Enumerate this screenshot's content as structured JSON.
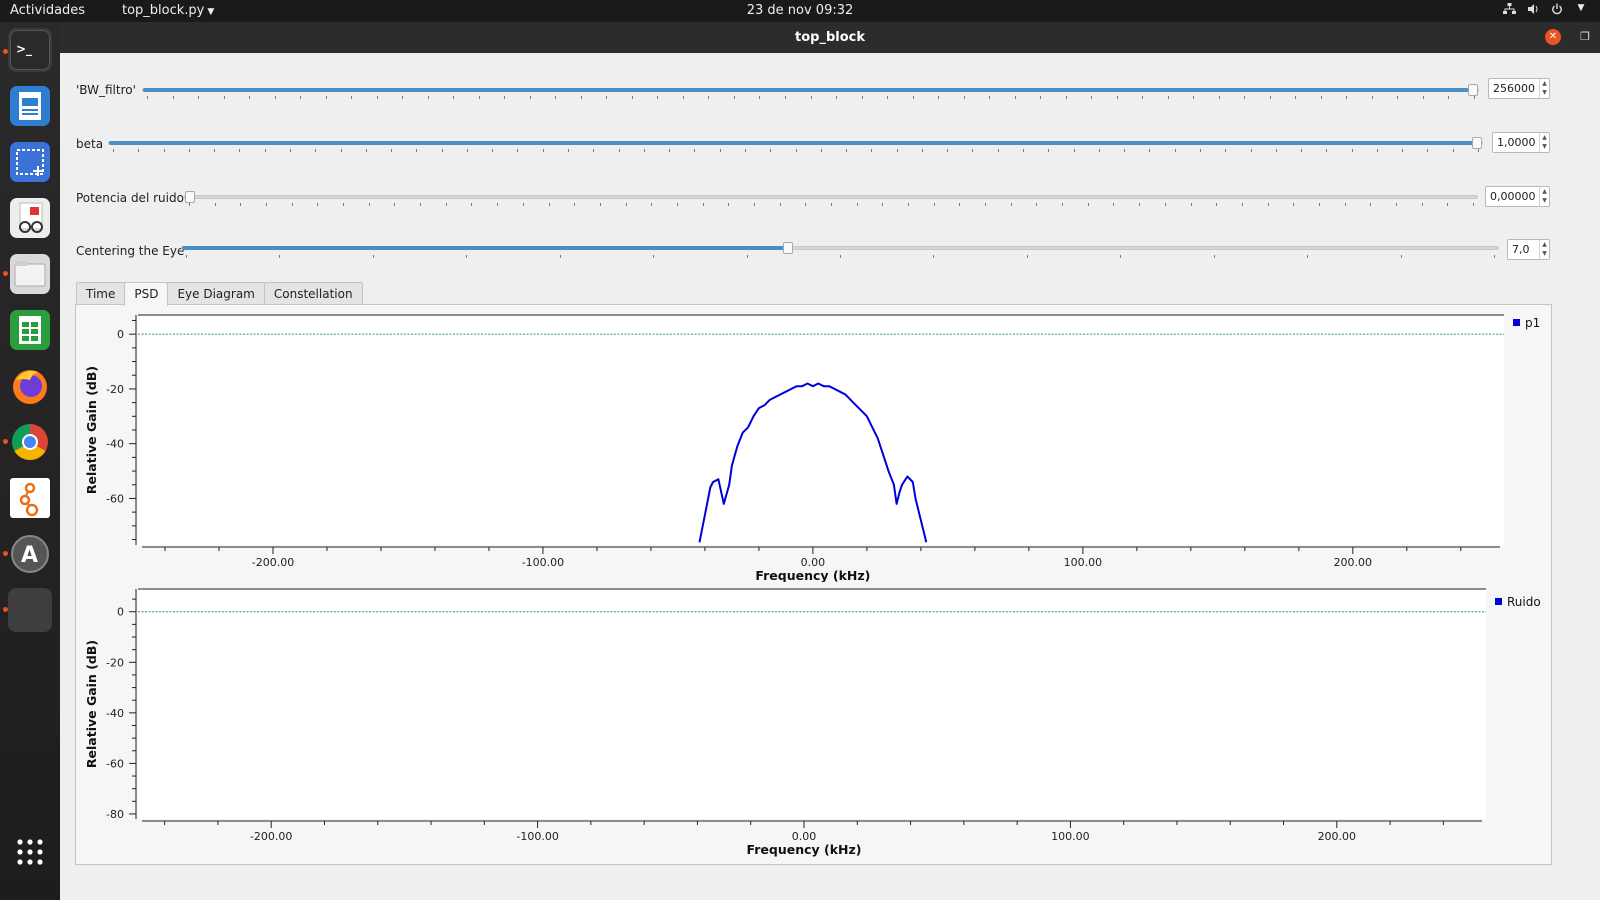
{
  "topbar": {
    "activities": "Actividades",
    "app_menu": "top_block.py",
    "clock": "23 de nov  09:32"
  },
  "window": {
    "title": "top_block"
  },
  "controls": [
    {
      "label": "'BW_filtro'",
      "value": "256000",
      "level": 1.0,
      "ticks": 53
    },
    {
      "label": "beta",
      "value": "1,0000",
      "level": 1.0,
      "ticks": 55
    },
    {
      "label": "Potencia del ruido",
      "value": "0,00000",
      "level": 0.0,
      "ticks": 51
    },
    {
      "label": "Centering the Eye",
      "value": "7,0",
      "level": 0.46,
      "ticks": 15
    }
  ],
  "tabs": [
    {
      "label": "Time",
      "active": false
    },
    {
      "label": "PSD",
      "active": true
    },
    {
      "label": "Eye Diagram",
      "active": false
    },
    {
      "label": "Constellation",
      "active": false
    }
  ],
  "colors": {
    "accent": "#4a90c4",
    "trace": "#0000dd",
    "ubuntu_orange": "#e95420"
  },
  "dock_icons": [
    "terminal-icon",
    "writer-icon",
    "screenshot-icon",
    "document-viewer-icon",
    "files-icon",
    "calc-icon",
    "firefox-icon",
    "chrome-icon",
    "gnuradio-icon",
    "software-updater-icon",
    "active-window-icon",
    "app-grid-icon"
  ],
  "chart_data": [
    {
      "type": "line",
      "title": "",
      "xlabel": "Frequency (kHz)",
      "ylabel": "Relative Gain (dB)",
      "xlim": [
        -250,
        256
      ],
      "ylim": [
        -77,
        7
      ],
      "x_ticks": [
        "-200.00",
        "-100.00",
        "0.00",
        "100.00",
        "200.00"
      ],
      "y_ticks": [
        "0",
        "-20",
        "-40",
        "-60"
      ],
      "reference_line_db": 0,
      "legend": "top-right",
      "series": [
        {
          "name": "p1",
          "x": [
            -42,
            -40,
            -38,
            -37,
            -35,
            -33,
            -31,
            -30,
            -28,
            -26,
            -24,
            -22,
            -20,
            -18,
            -16,
            -14,
            -12,
            -10,
            -8,
            -6,
            -4,
            -2,
            0,
            2,
            4,
            6,
            8,
            10,
            12,
            14,
            16,
            18,
            20,
            22,
            24,
            26,
            28,
            30,
            31,
            32,
            33,
            35,
            37,
            38,
            40,
            42
          ],
          "y": [
            -76,
            -66,
            -56,
            -54,
            -53,
            -62,
            -55,
            -48,
            -41,
            -36,
            -34,
            -30,
            -27,
            -26,
            -24,
            -23,
            -22,
            -21,
            -20,
            -19,
            -19,
            -18,
            -19,
            -18,
            -19,
            -19,
            -20,
            -21,
            -22,
            -24,
            -26,
            -28,
            -30,
            -34,
            -38,
            -44,
            -50,
            -55,
            -62,
            -58,
            -55,
            -52,
            -54,
            -60,
            -68,
            -76
          ]
        }
      ]
    },
    {
      "type": "line",
      "title": "",
      "xlabel": "Frequency (kHz)",
      "ylabel": "Relative Gain (dB)",
      "xlim": [
        -250,
        256
      ],
      "ylim": [
        -82,
        9
      ],
      "x_ticks": [
        "-200.00",
        "-100.00",
        "0.00",
        "100.00",
        "200.00"
      ],
      "y_ticks": [
        "0",
        "-20",
        "-40",
        "-60",
        "-80"
      ],
      "reference_line_db": 0,
      "legend": "top-right",
      "series": [
        {
          "name": "Ruido",
          "x": [],
          "y": []
        }
      ]
    }
  ]
}
